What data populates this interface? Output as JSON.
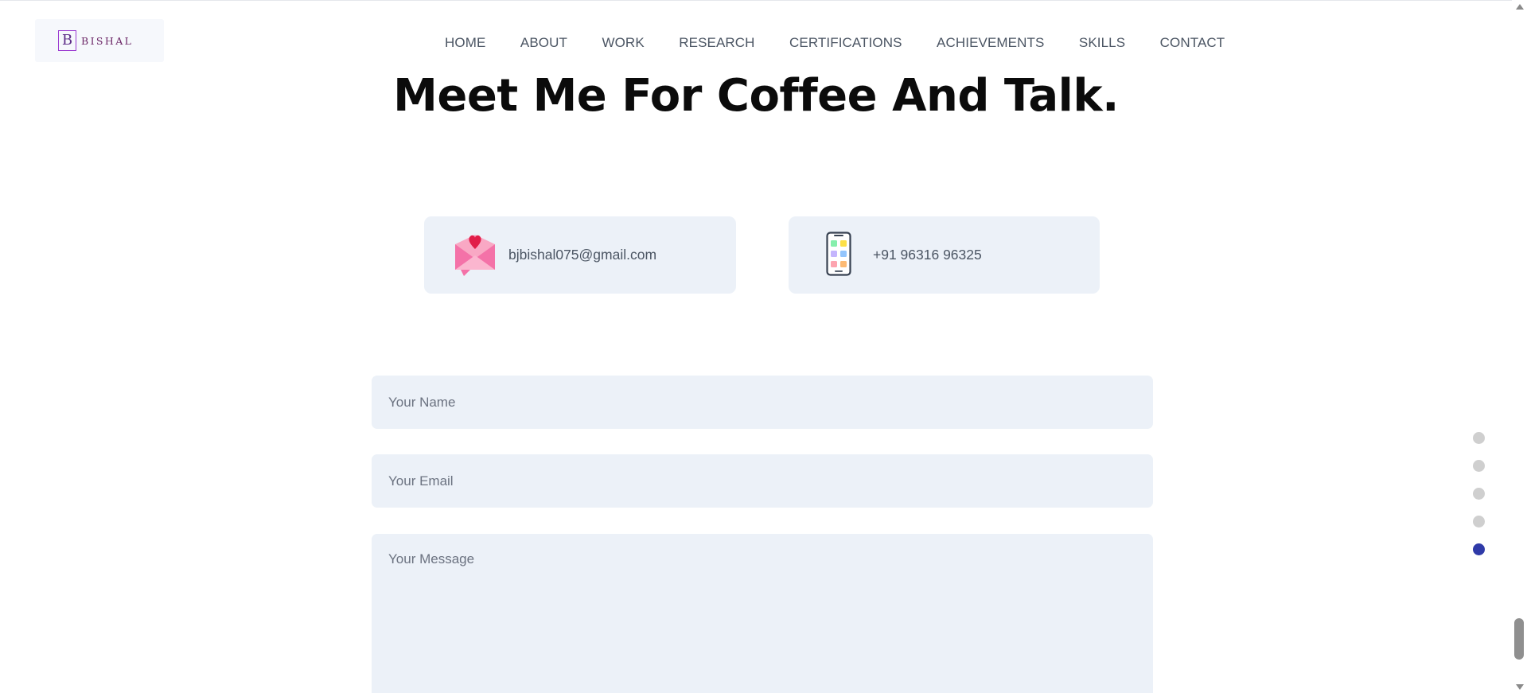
{
  "logo": {
    "initial": "B",
    "name": "BISHAL"
  },
  "nav": {
    "items": [
      "HOME",
      "ABOUT",
      "WORK",
      "RESEARCH",
      "CERTIFICATIONS",
      "ACHIEVEMENTS",
      "SKILLS",
      "CONTACT"
    ]
  },
  "contact": {
    "heading": "Meet Me For Coffee And Talk.",
    "email": "bjbishal075@gmail.com",
    "phone": "+91 96316 96325",
    "email_icon": "love-letter-icon",
    "phone_icon": "smartphone-icon"
  },
  "form": {
    "name_placeholder": "Your Name",
    "email_placeholder": "Your Email",
    "message_placeholder": "Your Message"
  },
  "section_dots": {
    "count": 5,
    "active_index": 5
  },
  "colors": {
    "accent": "#2f3aa8",
    "card_bg": "#ecf1f8",
    "heading": "#0b0b0b",
    "text": "#4b5563"
  }
}
